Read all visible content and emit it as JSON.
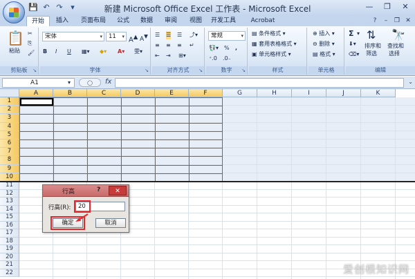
{
  "window": {
    "title": "新建 Microsoft Office Excel 工作表 - Microsoft Excel"
  },
  "ribbon_tabs": [
    "开始",
    "插入",
    "页面布局",
    "公式",
    "数据",
    "审阅",
    "视图",
    "开发工具",
    "Acrobat"
  ],
  "ribbon": {
    "clipboard": {
      "paste_label": "粘贴",
      "group_label": "剪贴板"
    },
    "font": {
      "font_name": "宋体",
      "font_size": "11",
      "bold": "B",
      "italic": "I",
      "underline": "U",
      "group_label": "字体"
    },
    "alignment": {
      "group_label": "对齐方式"
    },
    "number": {
      "format": "常规",
      "percent": "%",
      "comma": ",",
      "group_label": "数字"
    },
    "styles": {
      "conditional": "条件格式",
      "table_format": "套用表格格式",
      "cell_styles": "单元格样式",
      "group_label": "样式"
    },
    "cells": {
      "insert": "插入",
      "delete": "删除",
      "format": "格式",
      "group_label": "单元格"
    },
    "editing": {
      "sum": "Σ",
      "sort_filter_1": "排序和",
      "sort_filter_2": "筛选",
      "find_select_1": "查找和",
      "find_select_2": "选择",
      "group_label": "编辑"
    }
  },
  "formula_bar": {
    "name_box": "A1",
    "fx": "fx",
    "formula": ""
  },
  "columns": [
    "A",
    "B",
    "C",
    "D",
    "E",
    "F",
    "G",
    "H",
    "I",
    "J",
    "K"
  ],
  "rows": [
    "1",
    "2",
    "3",
    "4",
    "5",
    "6",
    "7",
    "8",
    "9",
    "10",
    "11",
    "12",
    "13",
    "14",
    "15",
    "16",
    "17",
    "18",
    "19",
    "20",
    "21",
    "22"
  ],
  "dialog": {
    "title": "行高",
    "help": "?",
    "close": "✕",
    "label": "行高(R):",
    "value": "20",
    "ok": "确定",
    "cancel": "取消"
  },
  "watermark": "爱创根知识网"
}
